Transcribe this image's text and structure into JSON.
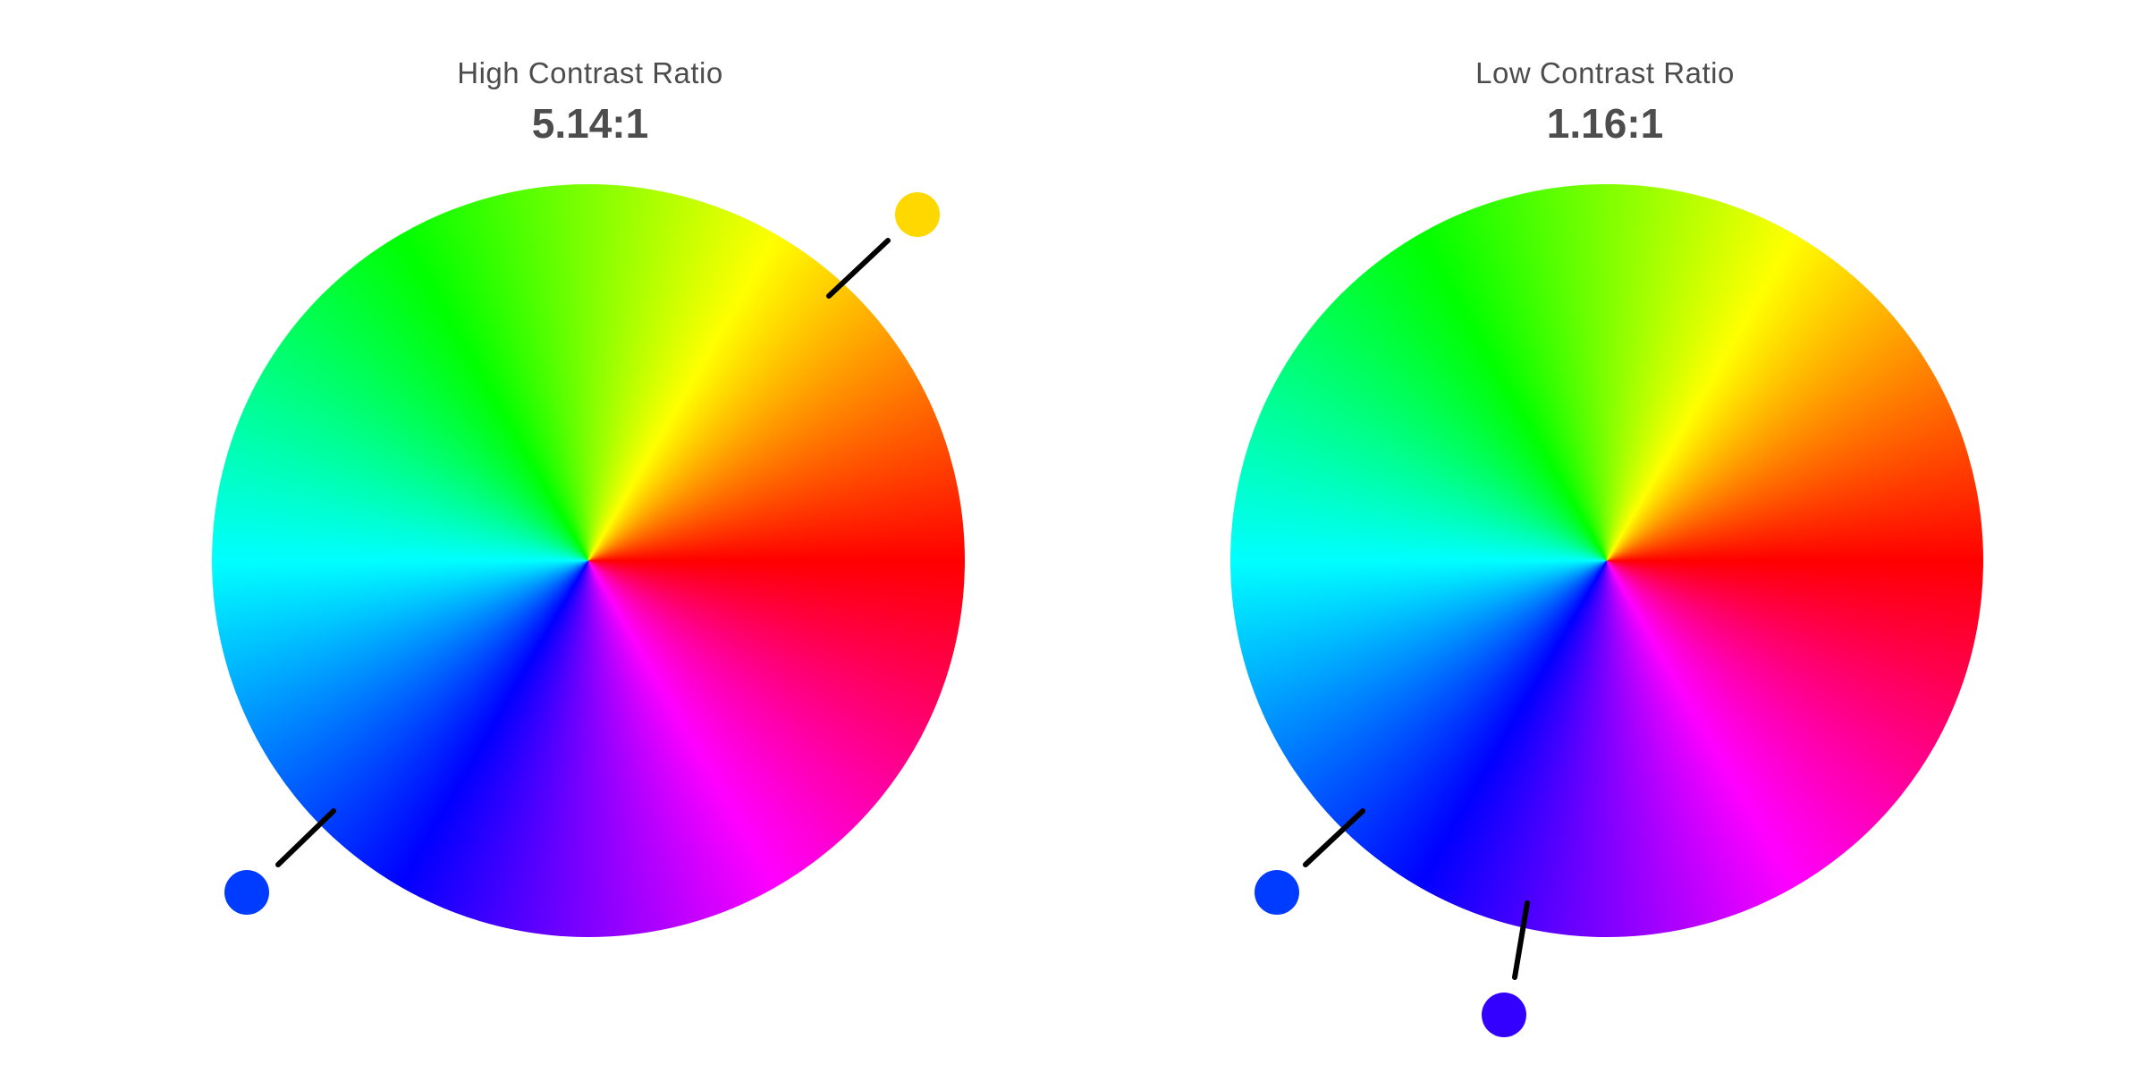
{
  "panels": [
    {
      "id": "high",
      "title": "High Contrast Ratio",
      "ratio": "5.14:1",
      "markers": [
        {
          "name": "yellow-color-marker",
          "color": "#FFD800"
        },
        {
          "name": "blue-color-marker",
          "color": "#003CFF"
        }
      ]
    },
    {
      "id": "low",
      "title": "Low Contrast Ratio",
      "ratio": "1.16:1",
      "markers": [
        {
          "name": "blue-color-marker",
          "color": "#003CFF"
        },
        {
          "name": "violet-color-marker",
          "color": "#3300FF"
        }
      ]
    }
  ],
  "wheel_hues": [
    "#FF0000",
    "#FF00FF",
    "#0000FF",
    "#00FFFF",
    "#00FF00",
    "#FFFF00"
  ],
  "connector_color": "#000000"
}
